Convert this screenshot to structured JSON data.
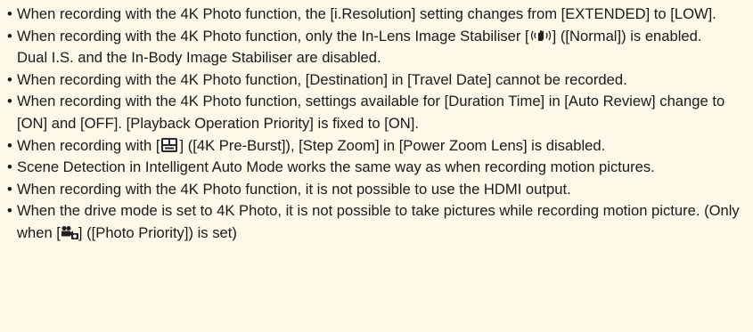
{
  "bullet": "•",
  "items": [
    {
      "text": "When recording with the 4K Photo function, the [i.Resolution] setting changes from [EXTENDED] to [LOW]."
    },
    {
      "before": "When recording with the 4K Photo function, only the In-Lens Image Stabiliser [",
      "icon": "stabiliser-hand-icon",
      "after": "] ([Normal]) is enabled.",
      "note": "Dual I.S. and the In-Body Image Stabiliser are disabled."
    },
    {
      "text": "When recording with the 4K Photo function, [Destination] in [Travel Date] cannot be recorded."
    },
    {
      "text": "When recording with the 4K Photo function, settings available for [Duration Time] in [Auto Review] change to [ON] and [OFF]. [Playback Operation Priority] is fixed to [ON]."
    },
    {
      "before": "When recording with [",
      "icon": "4k-pre-burst-icon",
      "after": "] ([4K Pre-Burst]), [Step Zoom] in [Power Zoom Lens] is disabled."
    },
    {
      "text": "Scene Detection in Intelligent Auto Mode works the same way as when recording motion pictures."
    },
    {
      "text": "When recording with the 4K Photo function, it is not possible to use the HDMI output."
    },
    {
      "before": "When the drive mode is set to 4K Photo, it is not possible to take pictures while recording motion picture. (Only when [",
      "icon": "photo-priority-icon",
      "after": "] ([Photo Priority]) is set)"
    }
  ],
  "colors": {
    "background": "#fdf8e8",
    "text": "#1a1a1a"
  }
}
